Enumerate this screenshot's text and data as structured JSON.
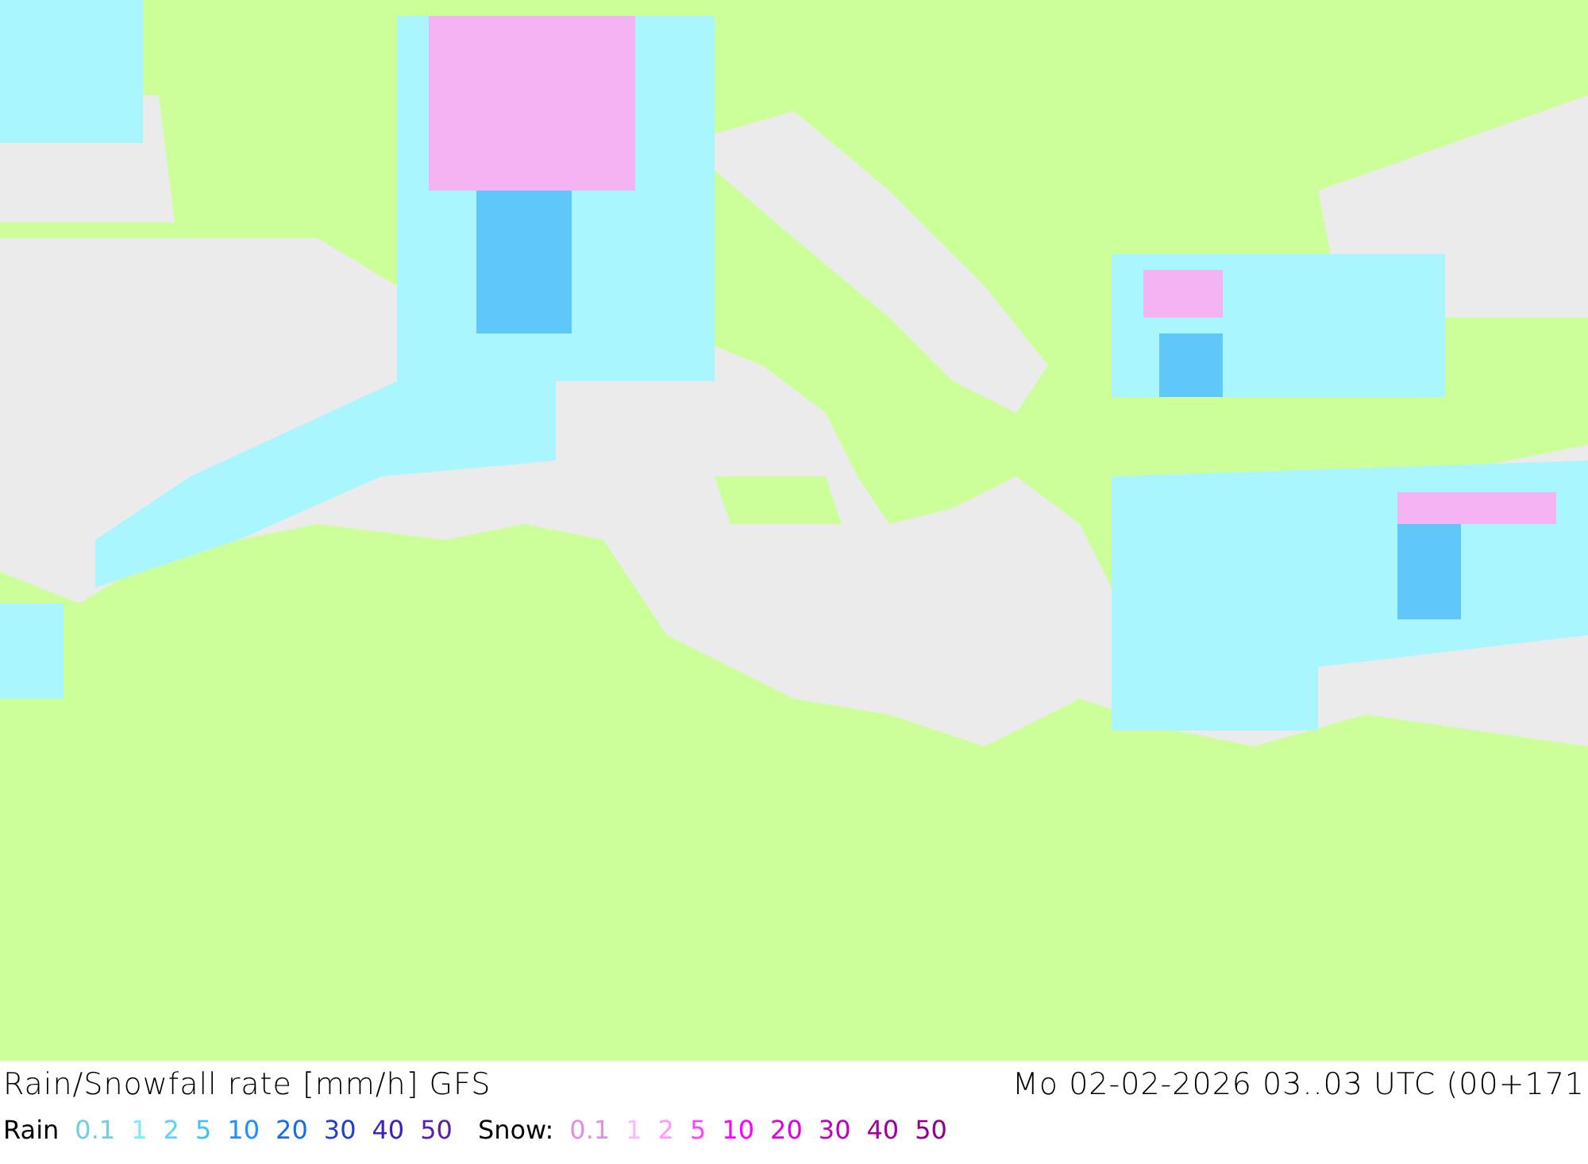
{
  "title": "Rain/Snowfall rate [mm/h] GFS",
  "datetime": "Mo 02-02-2026 03..03 UTC (00+171",
  "rain": {
    "label": "Rain",
    "scale": [
      {
        "value": "0.1",
        "color": "#70d0e0"
      },
      {
        "value": "1",
        "color": "#80e8ff"
      },
      {
        "value": "2",
        "color": "#60d0ff"
      },
      {
        "value": "5",
        "color": "#40c0ff"
      },
      {
        "value": "10",
        "color": "#1e90ff"
      },
      {
        "value": "20",
        "color": "#1870e0"
      },
      {
        "value": "30",
        "color": "#2040d0"
      },
      {
        "value": "40",
        "color": "#4020c0"
      },
      {
        "value": "50",
        "color": "#5820b0"
      }
    ]
  },
  "snow": {
    "label": "Snow:",
    "scale": [
      {
        "value": "0.1",
        "color": "#e090e0"
      },
      {
        "value": "1",
        "color": "#ffb8ff"
      },
      {
        "value": "2",
        "color": "#ff98ff"
      },
      {
        "value": "5",
        "color": "#ff40ff"
      },
      {
        "value": "10",
        "color": "#ff00ff"
      },
      {
        "value": "20",
        "color": "#e000e0"
      },
      {
        "value": "30",
        "color": "#c000c0"
      },
      {
        "value": "40",
        "color": "#a000a0"
      },
      {
        "value": "50",
        "color": "#900090"
      }
    ]
  }
}
